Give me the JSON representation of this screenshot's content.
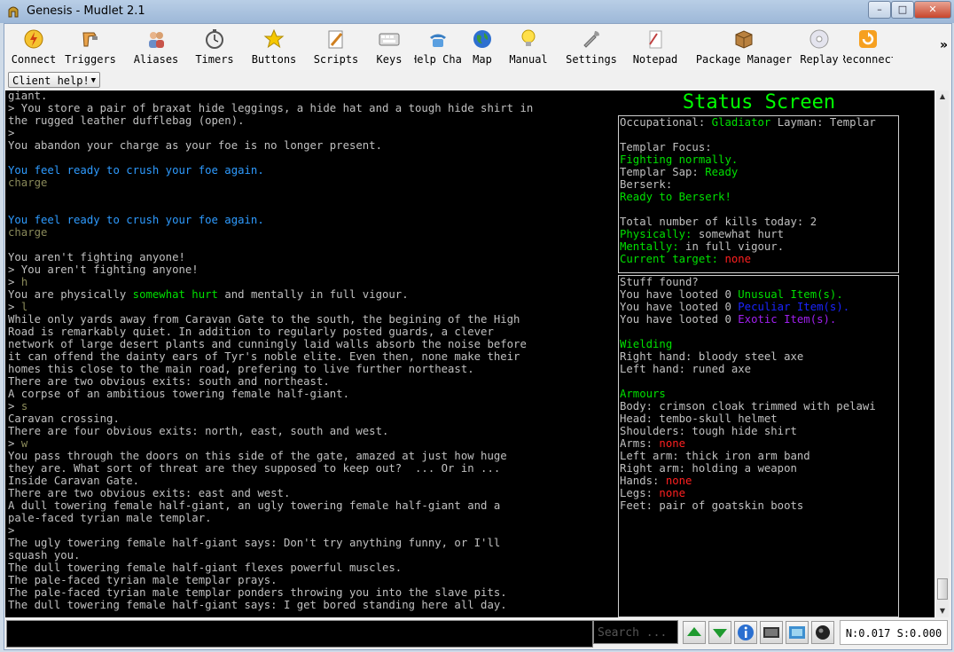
{
  "window": {
    "title": "Genesis - Mudlet 2.1"
  },
  "toolbar": {
    "items": [
      {
        "label": "Connect",
        "icon": "connect-icon"
      },
      {
        "label": "Triggers",
        "icon": "triggers-icon"
      },
      {
        "label": "Aliases",
        "icon": "aliases-icon"
      },
      {
        "label": "Timers",
        "icon": "timers-icon"
      },
      {
        "label": "Buttons",
        "icon": "buttons-icon"
      },
      {
        "label": "Scripts",
        "icon": "scripts-icon"
      },
      {
        "label": "Keys",
        "icon": "keys-icon"
      },
      {
        "label": "Help Chat",
        "icon": "help-chat-icon"
      },
      {
        "label": "Map",
        "icon": "map-icon"
      },
      {
        "label": "Manual",
        "icon": "manual-icon"
      },
      {
        "label": "Settings",
        "icon": "settings-icon"
      },
      {
        "label": "Notepad",
        "icon": "notepad-icon"
      },
      {
        "label": "Package Manager",
        "icon": "package-manager-icon"
      },
      {
        "label": "Replay",
        "icon": "replay-icon"
      },
      {
        "label": "Reconnect",
        "icon": "reconnect-icon"
      }
    ],
    "more": "»"
  },
  "client_help": {
    "label": "Client help!"
  },
  "console": {
    "lines": [
      [
        {
          "t": "giant.",
          "c": "white"
        }
      ],
      [
        {
          "t": "> You store a pair of braxat hide leggings, a hide hat and a tough hide shirt in",
          "c": "white"
        }
      ],
      [
        {
          "t": "the rugged leather dufflebag (open).",
          "c": "white"
        }
      ],
      [
        {
          "t": ">",
          "c": "white"
        }
      ],
      [
        {
          "t": "You abandon your charge as your foe is no longer present.",
          "c": "white"
        }
      ],
      [
        {
          "t": "",
          "c": "white"
        }
      ],
      [
        {
          "t": "You feel ready to crush your foe again.",
          "c": "blue"
        }
      ],
      [
        {
          "t": "charge",
          "c": "olive"
        }
      ],
      [
        {
          "t": "",
          "c": "white"
        }
      ],
      [
        {
          "t": "",
          "c": "white"
        }
      ],
      [
        {
          "t": "You feel ready to crush your foe again.",
          "c": "blue"
        }
      ],
      [
        {
          "t": "charge",
          "c": "olive"
        }
      ],
      [
        {
          "t": "",
          "c": "white"
        }
      ],
      [
        {
          "t": "You aren't fighting anyone!",
          "c": "white"
        }
      ],
      [
        {
          "t": "> You aren't fighting anyone!",
          "c": "white"
        }
      ],
      [
        {
          "t": "> ",
          "c": "white"
        },
        {
          "t": "h",
          "c": "olive"
        }
      ],
      [
        {
          "t": "You are physically ",
          "c": "white"
        },
        {
          "t": "somewhat hurt",
          "c": "green"
        },
        {
          "t": " and mentally in full vigour.",
          "c": "white"
        }
      ],
      [
        {
          "t": "> ",
          "c": "white"
        },
        {
          "t": "l",
          "c": "olive"
        }
      ],
      [
        {
          "t": "While only yards away from Caravan Gate to the south, the begining of the High",
          "c": "white"
        }
      ],
      [
        {
          "t": "Road is remarkably quiet. In addition to regularly posted guards, a clever",
          "c": "white"
        }
      ],
      [
        {
          "t": "network of large desert plants and cunningly laid walls absorb the noise before",
          "c": "white"
        }
      ],
      [
        {
          "t": "it can offend the dainty ears of Tyr's noble elite. Even then, none make their",
          "c": "white"
        }
      ],
      [
        {
          "t": "homes this close to the main road, prefering to live further northeast.",
          "c": "white"
        }
      ],
      [
        {
          "t": "There are two obvious exits: south and northeast.",
          "c": "white"
        }
      ],
      [
        {
          "t": "A corpse of an ambitious towering female half-giant.",
          "c": "white"
        }
      ],
      [
        {
          "t": "> ",
          "c": "white"
        },
        {
          "t": "s",
          "c": "olive"
        }
      ],
      [
        {
          "t": "Caravan crossing.",
          "c": "white"
        }
      ],
      [
        {
          "t": "There are four obvious exits: north, east, south and west.",
          "c": "white"
        }
      ],
      [
        {
          "t": "> ",
          "c": "white"
        },
        {
          "t": "w",
          "c": "olive"
        }
      ],
      [
        {
          "t": "You pass through the doors on this side of the gate, amazed at just how huge",
          "c": "white"
        }
      ],
      [
        {
          "t": "they are. What sort of threat are they supposed to keep out?  ... Or in ...",
          "c": "white"
        }
      ],
      [
        {
          "t": "Inside Caravan Gate.",
          "c": "white"
        }
      ],
      [
        {
          "t": "There are two obvious exits: east and west.",
          "c": "white"
        }
      ],
      [
        {
          "t": "A dull towering female half-giant, an ugly towering female half-giant and a",
          "c": "white"
        }
      ],
      [
        {
          "t": "pale-faced tyrian male templar.",
          "c": "white"
        }
      ],
      [
        {
          "t": ">",
          "c": "white"
        }
      ],
      [
        {
          "t": "The ugly towering female half-giant says: Don't try anything funny, or I'll",
          "c": "white"
        }
      ],
      [
        {
          "t": "squash you.",
          "c": "white"
        }
      ],
      [
        {
          "t": "The dull towering female half-giant flexes powerful muscles.",
          "c": "white"
        }
      ],
      [
        {
          "t": "The pale-faced tyrian male templar prays.",
          "c": "white"
        }
      ],
      [
        {
          "t": "The pale-faced tyrian male templar ponders throwing you into the slave pits.",
          "c": "white"
        }
      ],
      [
        {
          "t": "The dull towering female half-giant says: I get bored standing here all day.",
          "c": "white"
        }
      ]
    ]
  },
  "status": {
    "title": "Status Screen",
    "box1": [
      [
        {
          "t": "Occupational: ",
          "c": "white"
        },
        {
          "t": "Gladiator",
          "c": "green"
        },
        {
          "t": " Layman: Templar",
          "c": "white"
        }
      ],
      [
        {
          "t": "",
          "c": "white"
        }
      ],
      [
        {
          "t": "Templar Focus:",
          "c": "white"
        }
      ],
      [
        {
          "t": "Fighting normally.",
          "c": "green"
        }
      ],
      [
        {
          "t": "Templar Sap: ",
          "c": "white"
        },
        {
          "t": "Ready",
          "c": "green"
        }
      ],
      [
        {
          "t": "Berserk:",
          "c": "white"
        }
      ],
      [
        {
          "t": "Ready to Berserk!",
          "c": "green"
        }
      ],
      [
        {
          "t": "",
          "c": "white"
        }
      ],
      [
        {
          "t": "Total number of kills today: 2",
          "c": "white"
        }
      ],
      [
        {
          "t": "Physically:",
          "c": "green"
        },
        {
          "t": " somewhat hurt",
          "c": "white"
        }
      ],
      [
        {
          "t": "Mentally:",
          "c": "green"
        },
        {
          "t": " in full vigour.",
          "c": "white"
        }
      ],
      [
        {
          "t": "Current target: ",
          "c": "green"
        },
        {
          "t": "none",
          "c": "red"
        }
      ]
    ],
    "box2": [
      [
        {
          "t": "Stuff found?",
          "c": "white"
        }
      ],
      [
        {
          "t": "You have looted 0 ",
          "c": "white"
        },
        {
          "t": "Unusual Item(s).",
          "c": "green"
        }
      ],
      [
        {
          "t": "You have looted 0 ",
          "c": "white"
        },
        {
          "t": "Peculiar Item(s).",
          "c": "darkblue"
        }
      ],
      [
        {
          "t": "You have looted 0 ",
          "c": "white"
        },
        {
          "t": "Exotic Item(s).",
          "c": "purple"
        }
      ],
      [
        {
          "t": "",
          "c": "white"
        }
      ],
      [
        {
          "t": "Wielding",
          "c": "green"
        }
      ],
      [
        {
          "t": "Right hand: bloody steel axe",
          "c": "white"
        }
      ],
      [
        {
          "t": "Left hand: runed axe",
          "c": "white"
        }
      ],
      [
        {
          "t": "",
          "c": "white"
        }
      ],
      [
        {
          "t": "Armours",
          "c": "green"
        }
      ],
      [
        {
          "t": "Body: crimson cloak trimmed with pelawi",
          "c": "white"
        }
      ],
      [
        {
          "t": "Head: tembo-skull helmet",
          "c": "white"
        }
      ],
      [
        {
          "t": "Shoulders: tough hide shirt",
          "c": "white"
        }
      ],
      [
        {
          "t": "Arms: ",
          "c": "white"
        },
        {
          "t": "none",
          "c": "red"
        }
      ],
      [
        {
          "t": "Left arm: thick iron arm band",
          "c": "white"
        }
      ],
      [
        {
          "t": "Right arm: holding a weapon",
          "c": "white"
        }
      ],
      [
        {
          "t": "Hands: ",
          "c": "white"
        },
        {
          "t": "none",
          "c": "red"
        }
      ],
      [
        {
          "t": "Legs: ",
          "c": "white"
        },
        {
          "t": "none",
          "c": "red"
        }
      ],
      [
        {
          "t": "Feet: pair of goatskin boots",
          "c": "white"
        }
      ]
    ]
  },
  "bottom": {
    "search_placeholder": "Search ...",
    "buttons": [
      "scroll-up-icon",
      "scroll-down-icon",
      "info-icon",
      "timestamp-icon",
      "log-icon",
      "record-icon"
    ],
    "net_stats": "N:0.017 S:0.000"
  },
  "colors": {
    "white": "#c0c0c0",
    "blue": "#2e9bff",
    "olive": "#8a8a5a",
    "green": "#00e000",
    "red": "#ff2020",
    "darkblue": "#1a24ff",
    "purple": "#a020f0"
  }
}
